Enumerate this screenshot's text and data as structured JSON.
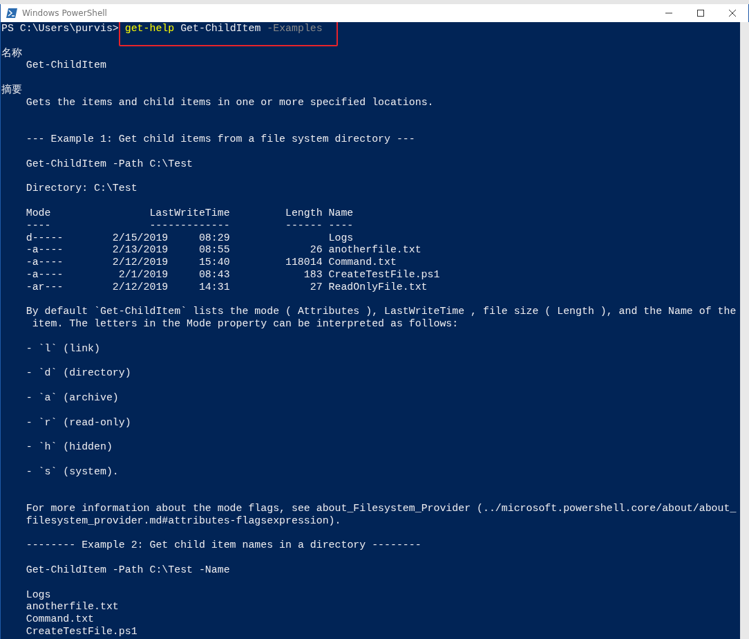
{
  "window": {
    "title": "Windows PowerShell"
  },
  "prompt": {
    "path": "PS C:\\Users\\purvis>",
    "command": "get-help",
    "argument": "Get-ChildItem",
    "parameter": "-Examples",
    "highlighted": true
  },
  "blocks": [
    {
      "lines": [
        {
          "text": "名称",
          "indented": false
        },
        {
          "text": "Get-ChildItem",
          "indented": true
        }
      ]
    },
    {
      "lines": [
        {
          "text": "摘要",
          "indented": false
        },
        {
          "text": "Gets the items and child items in one or more specified locations.",
          "indented": true
        }
      ]
    },
    {
      "wide_gap": true,
      "lines": [
        {
          "text": "--- Example 1: Get child items from a file system directory ---",
          "indented": true
        }
      ]
    },
    {
      "lines": [
        {
          "text": "Get-ChildItem -Path C:\\Test",
          "indented": true
        }
      ]
    },
    {
      "lines": [
        {
          "text": "Directory: C:\\Test",
          "indented": true
        }
      ]
    },
    {
      "kind": "table",
      "columns": [
        {
          "label": "Mode",
          "rule": "----"
        },
        {
          "label": "LastWriteTime",
          "rule": "-------------"
        },
        {
          "label": "Length",
          "rule": "------"
        },
        {
          "label": "Name",
          "rule": "----"
        }
      ],
      "rows": [
        {
          "mode": "d-----",
          "date": "2/15/2019",
          "time": "08:29",
          "name": "Logs"
        },
        {
          "mode": "-a----",
          "date": "2/13/2019",
          "time": "08:55",
          "length": "26",
          "name": "anotherfile.txt"
        },
        {
          "mode": "-a----",
          "date": "2/12/2019",
          "time": "15:40",
          "length": "118014",
          "name": "Command.txt"
        },
        {
          "mode": "-a----",
          "date": "2/1/2019",
          "time": "08:43",
          "length": "183",
          "name": "CreateTestFile.ps1"
        },
        {
          "mode": "-ar---",
          "date": "2/12/2019",
          "time": "14:31",
          "length": "27",
          "name": "ReadOnlyFile.txt"
        }
      ]
    },
    {
      "lines": [
        {
          "text": "By default `Get-ChildItem` lists the mode ( Attributes ), LastWriteTime , file size ( Length ), and the Name of the",
          "indented": true
        },
        {
          "text": "item. The letters in the Mode property can be interpreted as follows:",
          "indented": true,
          "hanging": true
        }
      ]
    },
    {
      "lines": [
        {
          "text": "- `l` (link)",
          "indented": true
        }
      ]
    },
    {
      "lines": [
        {
          "text": "- `d` (directory)",
          "indented": true
        }
      ]
    },
    {
      "lines": [
        {
          "text": "- `a` (archive)",
          "indented": true
        }
      ]
    },
    {
      "lines": [
        {
          "text": "- `r` (read-only)",
          "indented": true
        }
      ]
    },
    {
      "lines": [
        {
          "text": "- `h` (hidden)",
          "indented": true
        }
      ]
    },
    {
      "lines": [
        {
          "text": "- `s` (system).",
          "indented": true
        }
      ]
    },
    {
      "wide_gap": true,
      "lines": [
        {
          "text": "For more information about the mode flags, see about_Filesystem_Provider (../microsoft.powershell.core/about/about_",
          "indented": true
        },
        {
          "text": "filesystem_provider.md#attributes-flagsexpression).",
          "indented": true
        }
      ]
    },
    {
      "lines": [
        {
          "text": "-------- Example 2: Get child item names in a directory --------",
          "indented": true
        }
      ]
    },
    {
      "lines": [
        {
          "text": "Get-ChildItem -Path C:\\Test -Name",
          "indented": true
        }
      ]
    },
    {
      "lines": [
        {
          "text": "Logs",
          "indented": true
        },
        {
          "text": "anotherfile.txt",
          "indented": true
        },
        {
          "text": "Command.txt",
          "indented": true
        },
        {
          "text": "CreateTestFile.ps1",
          "indented": true
        }
      ]
    }
  ]
}
